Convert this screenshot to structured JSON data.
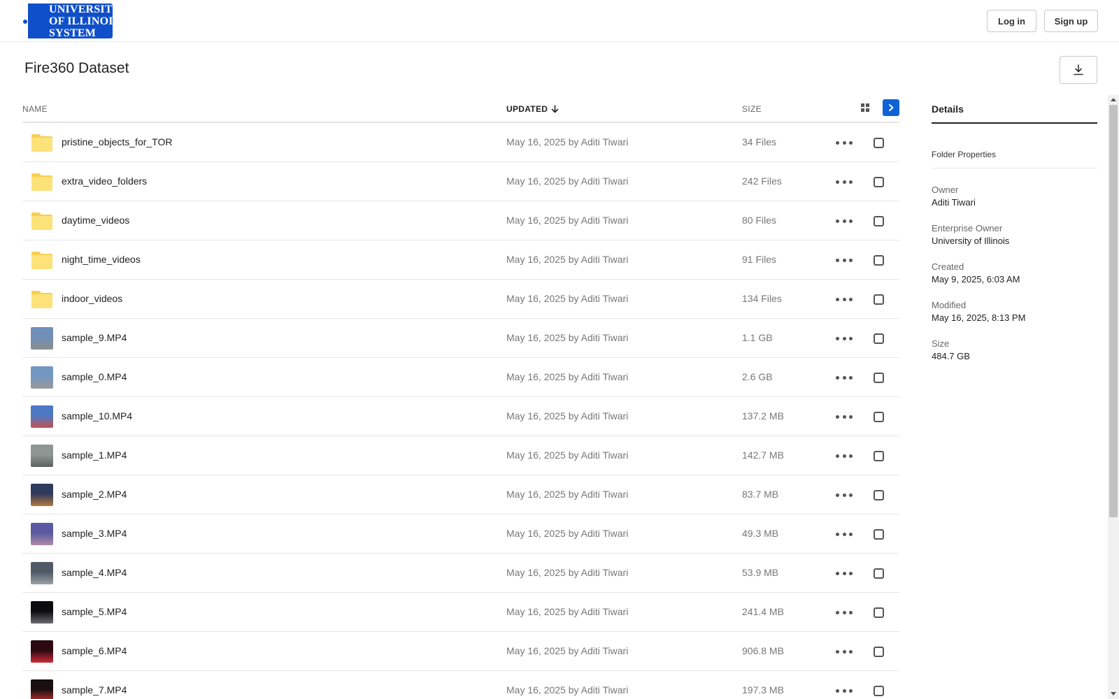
{
  "header": {
    "logo_lines": [
      "UNIVERSITY",
      "OF ILLINOIS",
      "SYSTEM"
    ],
    "login_label": "Log in",
    "signup_label": "Sign up"
  },
  "page": {
    "title": "Fire360 Dataset"
  },
  "list": {
    "columns": {
      "name": "NAME",
      "updated": "UPDATED",
      "size": "SIZE"
    },
    "rows": [
      {
        "name": "pristine_objects_for_TOR",
        "updated": "May 16, 2025 by Aditi Tiwari",
        "size": "34 Files",
        "kind": "folder"
      },
      {
        "name": "extra_video_folders",
        "updated": "May 16, 2025 by Aditi Tiwari",
        "size": "242 Files",
        "kind": "folder"
      },
      {
        "name": "daytime_videos",
        "updated": "May 16, 2025 by Aditi Tiwari",
        "size": "80 Files",
        "kind": "folder"
      },
      {
        "name": "night_time_videos",
        "updated": "May 16, 2025 by Aditi Tiwari",
        "size": "91 Files",
        "kind": "folder"
      },
      {
        "name": "indoor_videos",
        "updated": "May 16, 2025 by Aditi Tiwari",
        "size": "134 Files",
        "kind": "folder"
      },
      {
        "name": "sample_9.MP4",
        "updated": "May 16, 2025 by Aditi Tiwari",
        "size": "1.1 GB",
        "kind": "video",
        "colors": [
          "#6f8fb8",
          "#8a8f8a"
        ]
      },
      {
        "name": "sample_0.MP4",
        "updated": "May 16, 2025 by Aditi Tiwari",
        "size": "2.6 GB",
        "kind": "video",
        "colors": [
          "#7496c2",
          "#9a9a96"
        ]
      },
      {
        "name": "sample_10.MP4",
        "updated": "May 16, 2025 by Aditi Tiwari",
        "size": "137.2 MB",
        "kind": "video",
        "colors": [
          "#4d78c4",
          "#c45050"
        ]
      },
      {
        "name": "sample_1.MP4",
        "updated": "May 16, 2025 by Aditi Tiwari",
        "size": "142.7 MB",
        "kind": "video",
        "colors": [
          "#8f9694",
          "#5c6361"
        ]
      },
      {
        "name": "sample_2.MP4",
        "updated": "May 16, 2025 by Aditi Tiwari",
        "size": "83.7 MB",
        "kind": "video",
        "colors": [
          "#2e3a5e",
          "#b47a3c"
        ]
      },
      {
        "name": "sample_3.MP4",
        "updated": "May 16, 2025 by Aditi Tiwari",
        "size": "49.3 MB",
        "kind": "video",
        "colors": [
          "#5a5aa0",
          "#b08aa8"
        ]
      },
      {
        "name": "sample_4.MP4",
        "updated": "May 16, 2025 by Aditi Tiwari",
        "size": "53.9 MB",
        "kind": "video",
        "colors": [
          "#505a66",
          "#9aa0a6"
        ]
      },
      {
        "name": "sample_5.MP4",
        "updated": "May 16, 2025 by Aditi Tiwari",
        "size": "241.4 MB",
        "kind": "video",
        "colors": [
          "#0c0c0e",
          "#6a6a70"
        ]
      },
      {
        "name": "sample_6.MP4",
        "updated": "May 16, 2025 by Aditi Tiwari",
        "size": "906.8 MB",
        "kind": "video",
        "colors": [
          "#2a0a10",
          "#d02a3a"
        ]
      },
      {
        "name": "sample_7.MP4",
        "updated": "May 16, 2025 by Aditi Tiwari",
        "size": "197.3 MB",
        "kind": "video",
        "colors": [
          "#1a1010",
          "#c03030"
        ]
      }
    ]
  },
  "details": {
    "tab_label": "Details",
    "section_label": "Folder Properties",
    "properties": [
      {
        "label": "Owner",
        "value": "Aditi Tiwari"
      },
      {
        "label": "Enterprise Owner",
        "value": "University of Illinois"
      },
      {
        "label": "Created",
        "value": "May 9, 2025, 6:03 AM"
      },
      {
        "label": "Modified",
        "value": "May 16, 2025, 8:13 PM"
      },
      {
        "label": "Size",
        "value": "484.7 GB"
      }
    ]
  },
  "icons": {
    "folder": "folder-icon",
    "video": "video-thumbnail",
    "more": "more-options-icon",
    "download": "download-icon",
    "grid": "grid-view-icon",
    "chevron": "chevron-right-icon",
    "sort": "sort-down-arrow-icon"
  },
  "colors": {
    "accent": "#0f63d8",
    "logo_bg": "#0f4fc9",
    "folder": "#fde27a"
  }
}
